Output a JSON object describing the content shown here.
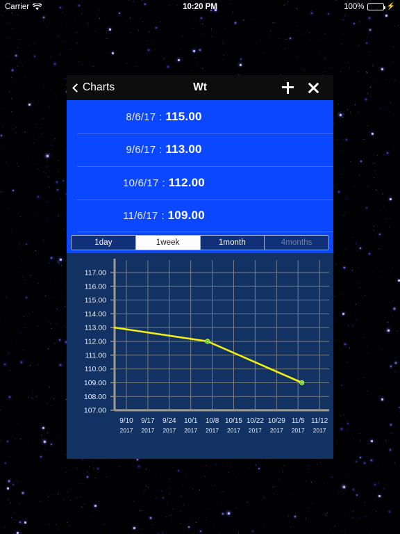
{
  "statusbar": {
    "carrier": "Carrier",
    "wifi_icon": "wifi-icon",
    "time": "10:20 PM",
    "battery_percent": "100%",
    "battery_icon": "battery-full-icon",
    "charging_icon": "lightning-bolt-icon"
  },
  "navbar": {
    "back_icon": "chevron-left-icon",
    "back_label": "Charts",
    "title": "Wt",
    "add_icon": "plus-icon",
    "close_icon": "close-x-icon"
  },
  "list": {
    "rows": [
      {
        "date": "8/6/17",
        "separator": ":",
        "value": "115.00"
      },
      {
        "date": "9/6/17",
        "separator": ":",
        "value": "113.00"
      },
      {
        "date": "10/6/17",
        "separator": ":",
        "value": "112.00"
      },
      {
        "date": "11/6/17",
        "separator": ":",
        "value": "109.00"
      }
    ]
  },
  "segmented_control": {
    "options": [
      {
        "label": "1day",
        "state": "normal"
      },
      {
        "label": "1week",
        "state": "selected"
      },
      {
        "label": "1month",
        "state": "normal"
      },
      {
        "label": "4months",
        "state": "disabled"
      }
    ]
  },
  "colors": {
    "list_blue": "#0b47fc",
    "chart_bg": "#123264",
    "segment_fill": "#11307a",
    "segment_border": "#9fb4d6",
    "line": "#f2ee13",
    "point": "#33cc33",
    "grid": "#8b8b84",
    "axis": "#a09c8c",
    "battery_green": "#4CD964"
  },
  "chart_data": {
    "type": "line",
    "title": "",
    "xlabel": "",
    "ylabel": "",
    "ylim": [
      107,
      117.6
    ],
    "yticks": [
      107.0,
      108.0,
      109.0,
      110.0,
      111.0,
      112.0,
      113.0,
      114.0,
      115.0,
      116.0,
      117.0
    ],
    "ytick_labels": [
      "107.00",
      "108.00",
      "109.00",
      "110.00",
      "111.00",
      "112.00",
      "113.00",
      "114.00",
      "115.00",
      "116.00",
      "117.00"
    ],
    "xticks": [
      "9/10",
      "9/17",
      "9/24",
      "10/1",
      "10/8",
      "10/15",
      "10/22",
      "10/29",
      "11/5",
      "11/12"
    ],
    "xtick_years": [
      "2017",
      "2017",
      "2017",
      "2017",
      "2017",
      "2017",
      "2017",
      "2017",
      "2017",
      "2017"
    ],
    "grid": true,
    "legend": false,
    "series": [
      {
        "name": "Wt",
        "color": "#f2ee13",
        "point_color": "#33cc33",
        "x": [
          "9/6",
          "10/6",
          "11/6"
        ],
        "y": [
          113.0,
          112.0,
          109.0
        ]
      }
    ]
  }
}
